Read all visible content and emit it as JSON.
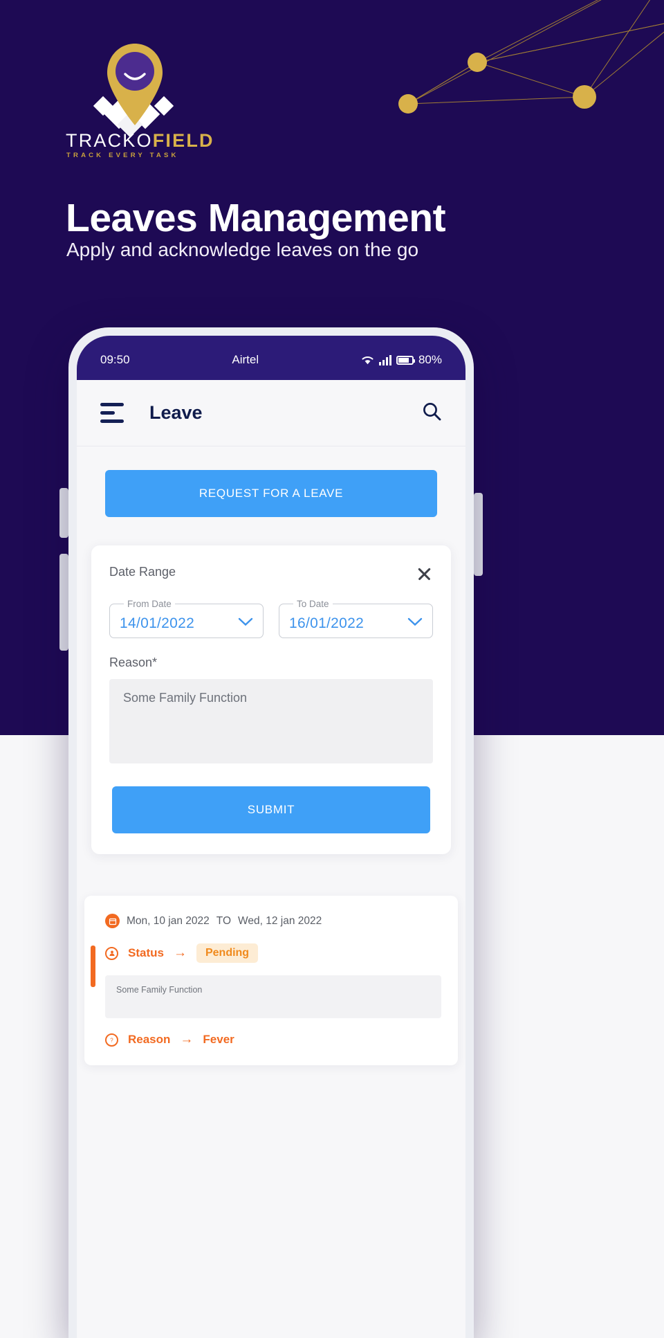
{
  "brand": {
    "name_light": "TRACKO",
    "name_bold": "FIELD",
    "tagline": "TRACK EVERY TASK",
    "pin_icon": "map-pin-icon",
    "accent_gold": "#d8b14a",
    "hero_bg": "#1e0a54"
  },
  "hero": {
    "title": "Leaves Management",
    "subtitle": "Apply and acknowledge leaves on the go"
  },
  "phone": {
    "statusbar": {
      "time": "09:50",
      "carrier": "Airtel",
      "wifi_icon": "wifi-icon",
      "signal_icon": "cellular-signal-icon",
      "battery_icon": "battery-icon",
      "battery": "80%"
    },
    "appbar": {
      "menu_icon": "hamburger-menu-icon",
      "title": "Leave",
      "search_icon": "search-icon"
    },
    "request_button": "REQUEST FOR A LEAVE",
    "form": {
      "date_range_label": "Date Range",
      "close_icon": "close-icon",
      "from": {
        "label": "From Date",
        "value": "14/01/2022",
        "chevron_icon": "chevron-down-icon"
      },
      "to": {
        "label": "To Date",
        "value": "16/01/2022",
        "chevron_icon": "chevron-down-icon"
      },
      "reason_label": "Reason*",
      "reason_value": "Some Family Function",
      "submit_label": "SUBMIT"
    },
    "history": [
      {
        "calendar_icon": "calendar-icon",
        "from_date": "Mon, 10 jan 2022",
        "to_word": "TO",
        "to_date": "Wed, 12 jan 2022",
        "status_icon": "user-status-icon",
        "status_label": "Status",
        "arrow": "→",
        "status_value": "Pending",
        "note": "Some Family Function",
        "reason_icon": "question-icon",
        "reason_label": "Reason",
        "reason_arrow": "→",
        "reason_value": "Fever"
      }
    ]
  },
  "colors": {
    "primary_blue": "#3fa0f7",
    "status_orange": "#f26a21",
    "badge_bg": "#fdecd4",
    "statusbar_purple": "#2c1b78"
  }
}
